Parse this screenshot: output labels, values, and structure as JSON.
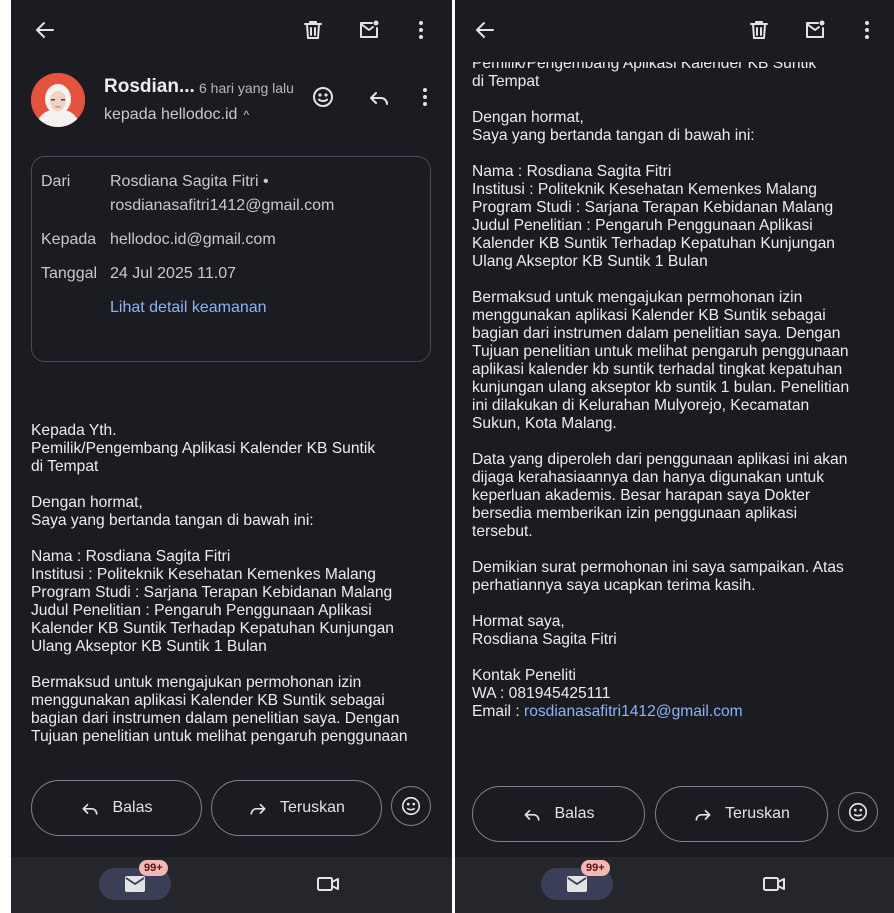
{
  "header": {
    "sender_name": "Rosdian...",
    "time": "6 hari yang lalu",
    "to_line": "kepada hellodoc.id",
    "chevron": "^"
  },
  "details": {
    "from_label": "Dari",
    "from_name": "Rosdiana Sagita Fitri •",
    "from_email": "rosdianasafitri1412@gmail.com",
    "to_label": "Kepada",
    "to_value": "hellodoc.id@gmail.com",
    "date_label": "Tanggal",
    "date_value": "24 Jul 2025 11.07",
    "security_link": "Lihat detail keamanan"
  },
  "email_left": {
    "p1": "Kepada Yth.\nPemilik/Pengembang Aplikasi Kalender KB Suntik\ndi Tempat",
    "p2": "Dengan hormat,\nSaya yang bertanda tangan di bawah ini:",
    "p3": "Nama : Rosdiana Sagita Fitri\nInstitusi : Politeknik Kesehatan Kemenkes Malang\nProgram Studi : Sarjana Terapan Kebidanan Malang\nJudul Penelitian : Pengaruh Penggunaan Aplikasi\nKalender KB Suntik Terhadap Kepatuhan Kunjungan\nUlang Akseptor KB Suntik 1 Bulan",
    "p4": "Bermaksud untuk mengajukan permohonan izin\nmenggunakan aplikasi Kalender KB Suntik sebagai\nbagian dari instrumen dalam penelitian saya. Dengan\nTujuan penelitian untuk melihat pengaruh penggunaan"
  },
  "email_right": {
    "p0": "Pemilik/Pengembang Aplikasi Kalender KB Suntik\ndi Tempat",
    "p2": "Dengan hormat,\nSaya yang bertanda tangan di bawah ini:",
    "p3": "Nama : Rosdiana Sagita Fitri\nInstitusi : Politeknik Kesehatan Kemenkes Malang\nProgram Studi : Sarjana Terapan Kebidanan Malang\nJudul Penelitian : Pengaruh Penggunaan Aplikasi\nKalender KB Suntik Terhadap Kepatuhan Kunjungan\nUlang Akseptor KB Suntik 1 Bulan",
    "p4": "Bermaksud untuk mengajukan permohonan izin\nmenggunakan aplikasi Kalender KB Suntik sebagai\nbagian dari instrumen dalam penelitian saya. Dengan\nTujuan penelitian untuk melihat pengaruh penggunaan\naplikasi kalender kb suntik terhadal tingkat kepatuhan\nkunjungan ulang akseptor kb suntik 1 bulan. Penelitian\nini dilakukan di Kelurahan Mulyorejo, Kecamatan\nSukun, Kota Malang.",
    "p5": "Data yang diperoleh dari penggunaan aplikasi ini akan\ndijaga kerahasiaannya dan hanya digunakan untuk\nkeperluan akademis. Besar harapan saya Dokter\nbersedia memberikan izin penggunaan aplikasi\ntersebut.",
    "p6": "Demikian surat permohonan ini saya sampaikan. Atas\nperhatiannya saya ucapkan terima kasih.",
    "p7": "Hormat saya,\nRosdiana Sagita Fitri",
    "p8": "Kontak Peneliti\nWA : 081945425111",
    "email_label": "Email : ",
    "email_value": "rosdianasafitri1412@gmail.com"
  },
  "actions": {
    "reply": "Balas",
    "forward": "Teruskan"
  },
  "nav": {
    "badge": "99+"
  },
  "icons": {
    "back": "arrow-left-icon",
    "delete": "trash-icon",
    "mark_unread": "mail-unread-icon",
    "more": "more-vert-icon",
    "emoji": "emoji-icon",
    "reply": "reply-icon",
    "forward": "forward-icon",
    "mail": "mail-icon",
    "video": "video-icon"
  },
  "colors": {
    "background": "#1b1c21",
    "link": "#8ab4f8",
    "badge": "#f2b8b5",
    "avatar": "#e5533d"
  }
}
